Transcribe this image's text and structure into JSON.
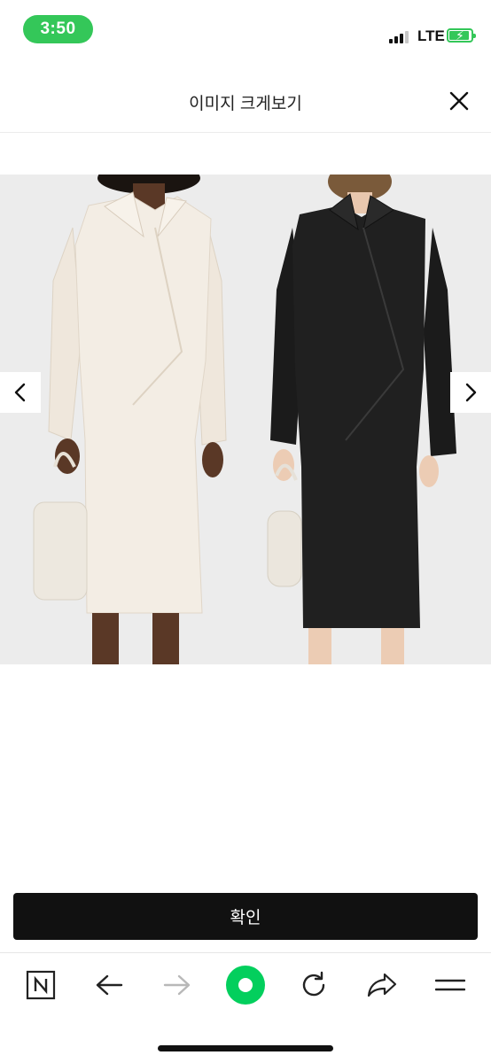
{
  "status_bar": {
    "time": "3:50",
    "network": "LTE",
    "signal_bars": 3,
    "battery_charging": true,
    "accent_color": "#34c759"
  },
  "header": {
    "title": "이미지 크게보기",
    "close_icon": "close-icon"
  },
  "viewer": {
    "prev_icon": "chevron-left-icon",
    "next_icon": "chevron-right-icon",
    "image_description_icon": "product-photo-two-dresses"
  },
  "confirm": {
    "label": "확인"
  },
  "toolbar": {
    "items": [
      {
        "icon": "naver-n-icon"
      },
      {
        "icon": "back-arrow-icon"
      },
      {
        "icon": "forward-arrow-icon",
        "disabled": true
      },
      {
        "icon": "green-dot-home-icon",
        "color": "#03cf5d"
      },
      {
        "icon": "refresh-icon"
      },
      {
        "icon": "share-icon"
      },
      {
        "icon": "menu-icon"
      }
    ]
  }
}
